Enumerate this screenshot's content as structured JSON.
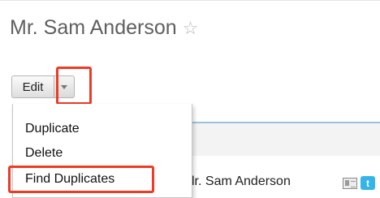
{
  "record": {
    "title": "Mr. Sam Anderson",
    "favorite_icon": "star-outline-icon"
  },
  "actions": {
    "edit_label": "Edit",
    "dropdown_icon": "caret-down-icon",
    "menu_items": [
      "Duplicate",
      "Delete",
      "Find Duplicates"
    ]
  },
  "background": {
    "name_text": "lr. Sam Anderson",
    "icons": [
      "vcard-icon",
      "twitter-icon"
    ]
  },
  "colors": {
    "highlight": "#ee3b25",
    "tab_rule": "#9fbfe0",
    "twitter": "#33b5e9"
  }
}
